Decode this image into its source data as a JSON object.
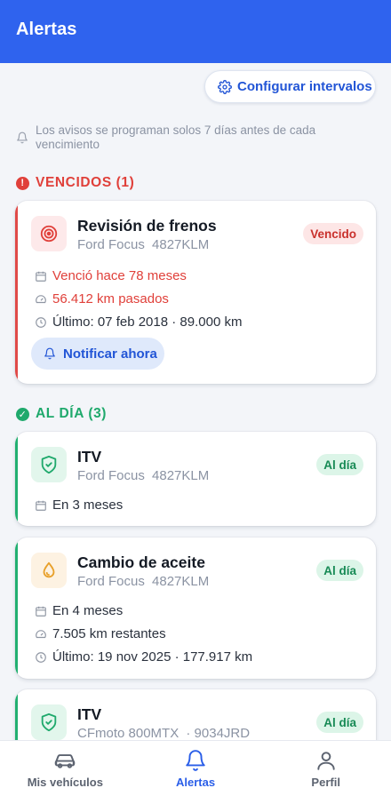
{
  "header": {
    "title": "Alertas"
  },
  "actions": {
    "configure_label": "Configurar intervalos"
  },
  "notice": {
    "text": "Los avisos se programan solos 7 días antes de cada vencimiento"
  },
  "sections": {
    "overdue": {
      "label": "VENCIDOS (1)",
      "color": "#e0403a"
    },
    "ok": {
      "label": "AL DÍA (3)",
      "color": "#1fa96c"
    }
  },
  "cards": [
    {
      "title": "Revisión de frenos",
      "vehicle": "Ford Focus",
      "plate": "4827KLM",
      "badge": "Vencido",
      "icon": "target-icon",
      "rows": [
        {
          "icon": "calendar-icon",
          "text": "Venció hace 78 meses"
        },
        {
          "icon": "gauge-icon",
          "text": "56.412 km pasados"
        },
        {
          "icon": "clock-icon",
          "text": "Último: 07 feb 2018 · 89.000 km"
        }
      ],
      "button": "Notificar ahora"
    },
    {
      "title": "ITV",
      "vehicle": "Ford Focus",
      "plate": "4827KLM",
      "badge": "Al día",
      "icon": "shield-check-icon",
      "rows": [
        {
          "icon": "calendar-icon",
          "text": "En 3 meses"
        }
      ]
    },
    {
      "title": "Cambio de aceite",
      "vehicle": "Ford Focus",
      "plate": "4827KLM",
      "badge": "Al día",
      "icon": "oil-drop-icon",
      "rows": [
        {
          "icon": "calendar-icon",
          "text": "En 4 meses"
        },
        {
          "icon": "gauge-icon",
          "text": "7.505 km restantes"
        },
        {
          "icon": "clock-icon",
          "text": "Último: 19 nov 2025 · 177.917 km"
        }
      ]
    },
    {
      "title": "ITV",
      "vehicle": "CFmoto 800MTX",
      "plate": "· 9034JRD",
      "badge": "Al día",
      "icon": "shield-check-icon",
      "rows": []
    }
  ],
  "nav": {
    "items": [
      {
        "label": "Mis vehículos",
        "icon": "car-icon"
      },
      {
        "label": "Alertas",
        "icon": "bell-icon",
        "active": true
      },
      {
        "label": "Perfil",
        "icon": "user-icon"
      }
    ]
  },
  "colors": {
    "primary": "#2f63ee",
    "danger": "#e0403a",
    "success": "#1fa96c"
  }
}
